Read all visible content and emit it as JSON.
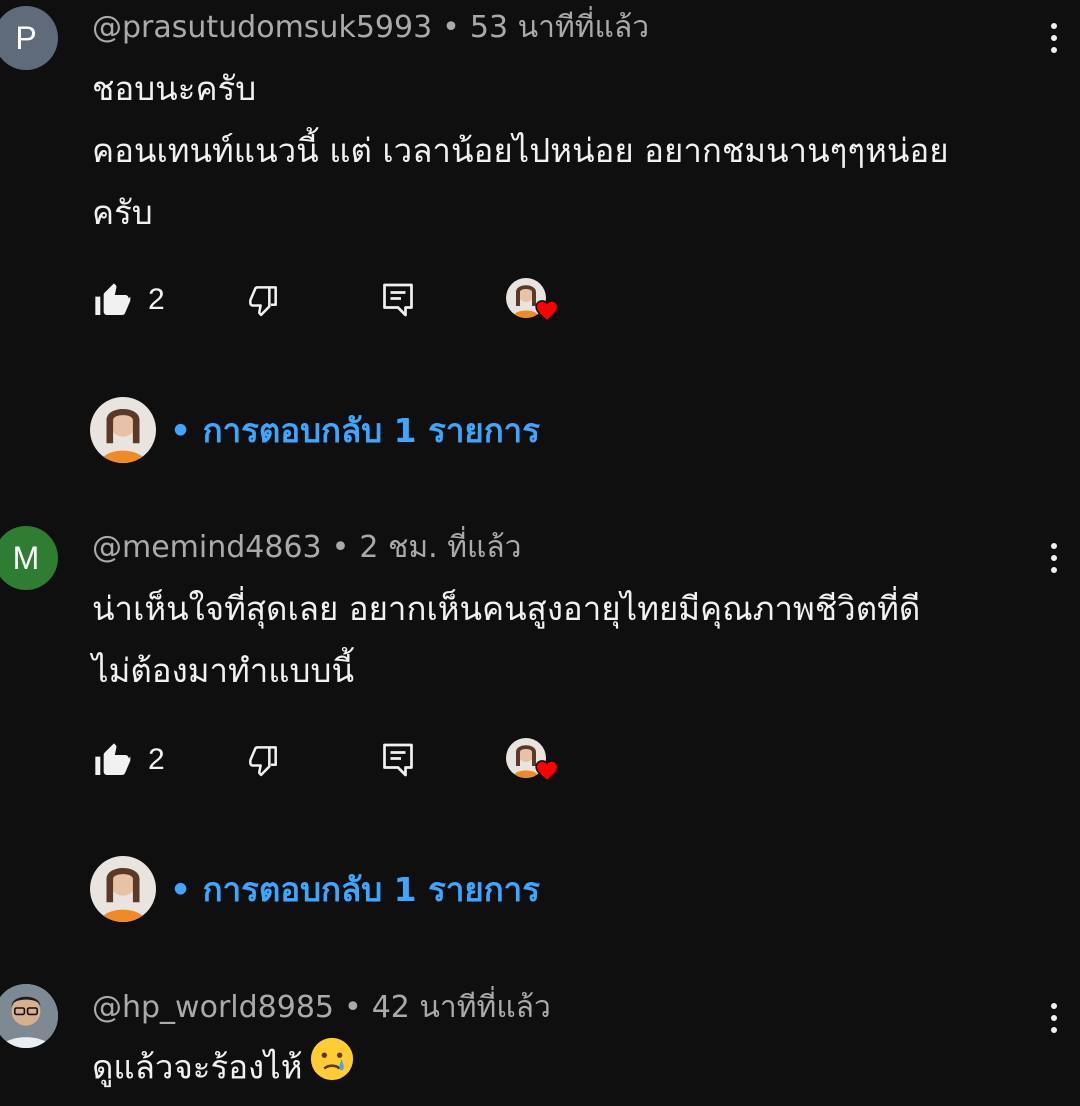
{
  "comments": [
    {
      "avatar_letter": "P",
      "avatar_color": "#5f6b7a",
      "handle": "@prasutudomsuk5993",
      "time": "53 นาทีที่แล้ว",
      "lines": [
        "ชอบนะครับ",
        "คอนเทนท์แนวนี้  แต่ เวลาน้อยไปหน่อย  อยากชมนานๆๆหน่อย",
        "ครับ"
      ],
      "likes": "2",
      "hearted_by_creator": true,
      "replies_label": "การตอบกลับ 1 รายการ"
    },
    {
      "avatar_letter": "M",
      "avatar_color": "#2e7d32",
      "handle": "@memind4863",
      "time": "2 ชม. ที่แล้ว",
      "lines": [
        "น่าเห็นใจที่สุดเลย อยากเห็นคนสูงอายุไทยมีคุณภาพชีวิตที่ดี",
        "ไม่ต้องมาทำแบบนี้"
      ],
      "likes": "2",
      "hearted_by_creator": true,
      "replies_label": "การตอบกลับ 1 รายการ"
    },
    {
      "avatar_letter": "",
      "avatar_color": "#8a8f96",
      "handle": "@hp_world8985",
      "time": "42 นาทีที่แล้ว",
      "lines": [
        "ดูแล้วจะร้องไห้"
      ],
      "emoji": "crying-face"
    }
  ],
  "colors": {
    "background": "#0f0f0f",
    "primary_text": "#f1f1f1",
    "secondary_text": "#aaaaaa",
    "reply_link": "#3ea6ff",
    "heart": "#ff0000"
  },
  "icons": [
    "thumbs-up-icon",
    "thumbs-down-icon",
    "reply-icon",
    "creator-heart-icon",
    "more-vert-icon",
    "crying-face-emoji"
  ]
}
